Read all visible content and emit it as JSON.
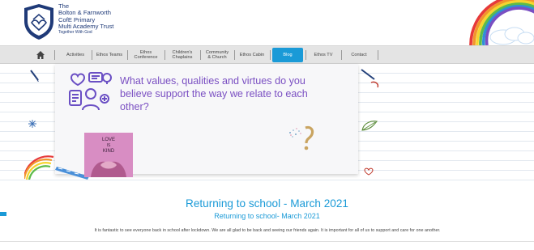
{
  "brand": {
    "line1": "The",
    "line2": "Bolton & Farnworth",
    "line3": "CofE Primary",
    "line4": "Multi Academy Trust",
    "tagline": "Together With God"
  },
  "nav": {
    "items": [
      {
        "label": "Activities"
      },
      {
        "label": "Ethos Teams"
      },
      {
        "label": "Ethos\nConference"
      },
      {
        "label": "Children's\nChaplains"
      },
      {
        "label": "Community\n& Church"
      },
      {
        "label": "Ethos Cabin"
      },
      {
        "label": "Blog"
      },
      {
        "label": "Ethos TV"
      },
      {
        "label": "Contact"
      }
    ],
    "active": "Blog"
  },
  "banner": {
    "question": "What values, qualities and virtues do you believe support the way we relate to each other?",
    "love_card": {
      "line1": "LOVE",
      "line2": "IS",
      "line3": "KIND"
    }
  },
  "article": {
    "title": "Returning to school - March 2021",
    "subtitle": "Returning to school- March 2021",
    "body": "It is fantastic to see everyone back in school after lockdown. We are all glad to be back and seeing our friends again. It is important for all of us to support and care for one another."
  },
  "colors": {
    "accent": "#1a9ad7",
    "question": "#7a4fc2",
    "nav_bg": "#e4e4e4",
    "brand": "#1f3a78"
  },
  "icons": {
    "home": "home-icon",
    "logo": "school-crest-icon"
  }
}
